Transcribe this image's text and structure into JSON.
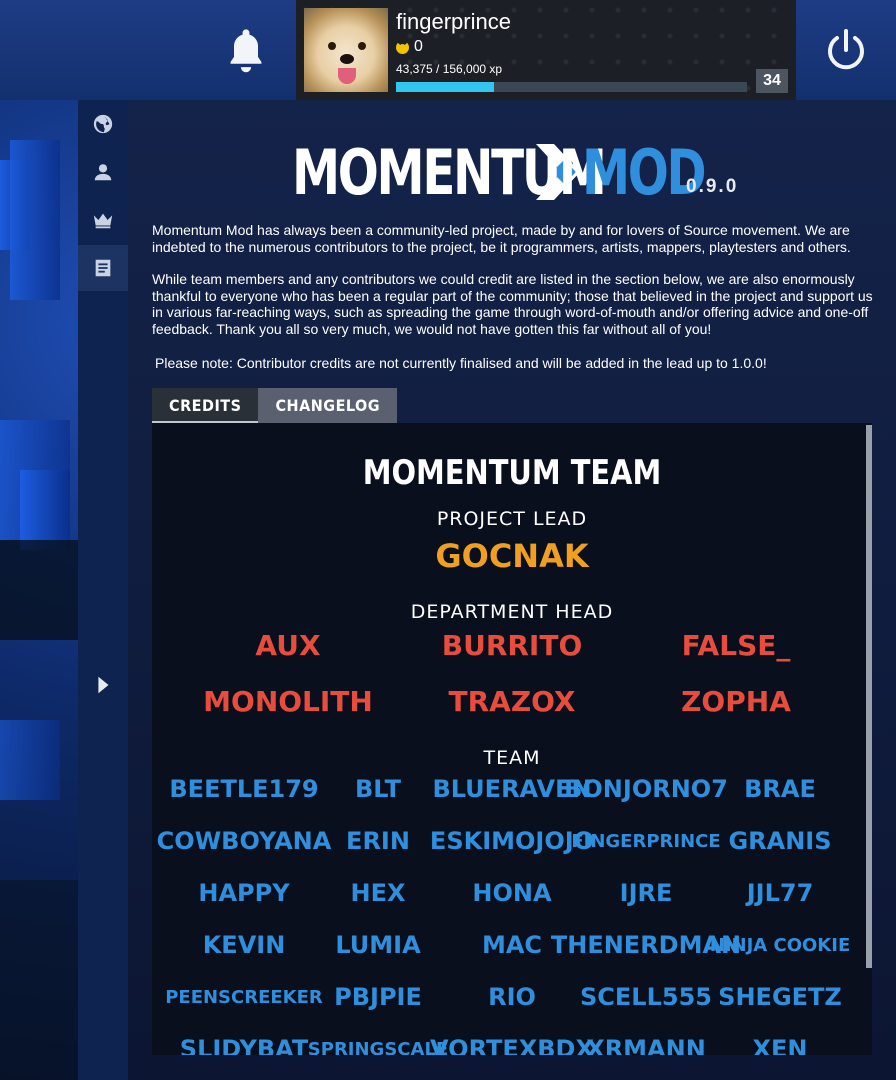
{
  "profile": {
    "username": "fingerprince",
    "currency": "0",
    "xp_text": "43,375 / 156,000 xp",
    "xp_progress": 0.278,
    "level": "34"
  },
  "colors": {
    "accent_blue": "#2f8fdd",
    "lead_orange": "#f0a020",
    "dept_red": "#e84c3c",
    "xp_bar": "#33c6f0"
  },
  "nav": {
    "items": [
      {
        "icon": "globe-icon"
      },
      {
        "icon": "user-icon"
      },
      {
        "icon": "crown-icon"
      },
      {
        "icon": "document-icon"
      }
    ],
    "expand_icon": "chevron-right-icon"
  },
  "logo": {
    "left": "MOMENTUM",
    "right": "MOD",
    "version": "0.9.0"
  },
  "intro": {
    "p1": "Momentum Mod has always been a community-led project, made by and for lovers of Source movement. We are indebted to the numerous contributors to the project, be it programmers, artists, mappers, playtesters and others.",
    "p2": "While team members and any contributors we could credit are listed in the section below, we are also enormously thankful to everyone who has been a regular part of the community; those that believed in the project and support us in various far-reaching ways, such as spreading the game through word-of-mouth and/or offering advice and one-off feedback. Thank you all so very much, we would not have gotten this far without all of you!",
    "note": "Please note: Contributor credits are not currently finalised and will be added in the lead up to 1.0.0!"
  },
  "tabs": {
    "credits": "CREDITS",
    "changelog": "CHANGELOG"
  },
  "credits": {
    "title": "MOMENTUM TEAM",
    "project_lead_label": "PROJECT LEAD",
    "project_lead": "GOCNAK",
    "dept_head_label": "DEPARTMENT HEAD",
    "dept_heads": [
      "AUX",
      "BURRITO",
      "FALSE_",
      "MONOLITH",
      "TRAZOX",
      "ZOPHA"
    ],
    "team_label": "TEAM",
    "team": [
      "BEETLE179",
      "BLT",
      "BLUERAVEN",
      "BONJORNO7",
      "BRAE",
      "COWBOYANA",
      "ERIN",
      "ESKIMOJOJO",
      "FINGERPRINCE",
      "GRANIS",
      "HAPPY",
      "HEX",
      "HONA",
      "IJRE",
      "JJL77",
      "KEVIN",
      "LUMIA",
      "MAC",
      "THENERDMAN",
      "NINJA COOKIE",
      "PEENSCREEKER",
      "PBJPIE",
      "RIO",
      "SCELL555",
      "SHEGETZ",
      "SLIDYBAT",
      "SPRINGSCALE",
      "VORTEXBDX",
      "XRMANN",
      "XEN"
    ]
  }
}
